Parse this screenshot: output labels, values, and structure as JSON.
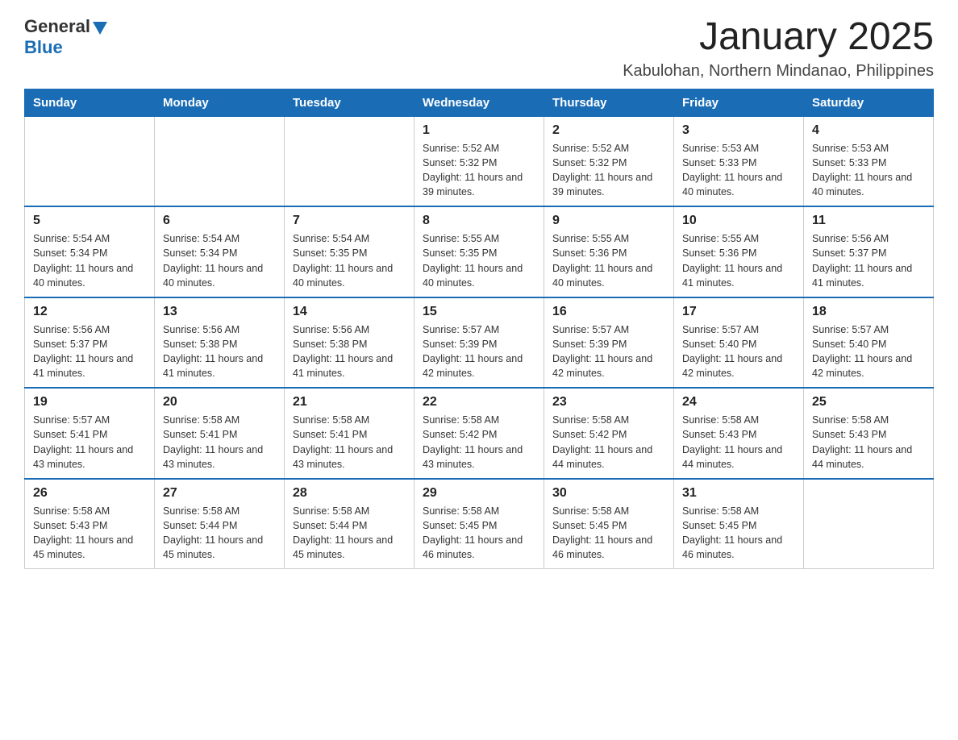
{
  "header": {
    "logo": {
      "general": "General",
      "blue": "Blue"
    },
    "title": "January 2025",
    "subtitle": "Kabulohan, Northern Mindanao, Philippines"
  },
  "columns": [
    "Sunday",
    "Monday",
    "Tuesday",
    "Wednesday",
    "Thursday",
    "Friday",
    "Saturday"
  ],
  "weeks": [
    [
      {
        "day": "",
        "info": ""
      },
      {
        "day": "",
        "info": ""
      },
      {
        "day": "",
        "info": ""
      },
      {
        "day": "1",
        "info": "Sunrise: 5:52 AM\nSunset: 5:32 PM\nDaylight: 11 hours and 39 minutes."
      },
      {
        "day": "2",
        "info": "Sunrise: 5:52 AM\nSunset: 5:32 PM\nDaylight: 11 hours and 39 minutes."
      },
      {
        "day": "3",
        "info": "Sunrise: 5:53 AM\nSunset: 5:33 PM\nDaylight: 11 hours and 40 minutes."
      },
      {
        "day": "4",
        "info": "Sunrise: 5:53 AM\nSunset: 5:33 PM\nDaylight: 11 hours and 40 minutes."
      }
    ],
    [
      {
        "day": "5",
        "info": "Sunrise: 5:54 AM\nSunset: 5:34 PM\nDaylight: 11 hours and 40 minutes."
      },
      {
        "day": "6",
        "info": "Sunrise: 5:54 AM\nSunset: 5:34 PM\nDaylight: 11 hours and 40 minutes."
      },
      {
        "day": "7",
        "info": "Sunrise: 5:54 AM\nSunset: 5:35 PM\nDaylight: 11 hours and 40 minutes."
      },
      {
        "day": "8",
        "info": "Sunrise: 5:55 AM\nSunset: 5:35 PM\nDaylight: 11 hours and 40 minutes."
      },
      {
        "day": "9",
        "info": "Sunrise: 5:55 AM\nSunset: 5:36 PM\nDaylight: 11 hours and 40 minutes."
      },
      {
        "day": "10",
        "info": "Sunrise: 5:55 AM\nSunset: 5:36 PM\nDaylight: 11 hours and 41 minutes."
      },
      {
        "day": "11",
        "info": "Sunrise: 5:56 AM\nSunset: 5:37 PM\nDaylight: 11 hours and 41 minutes."
      }
    ],
    [
      {
        "day": "12",
        "info": "Sunrise: 5:56 AM\nSunset: 5:37 PM\nDaylight: 11 hours and 41 minutes."
      },
      {
        "day": "13",
        "info": "Sunrise: 5:56 AM\nSunset: 5:38 PM\nDaylight: 11 hours and 41 minutes."
      },
      {
        "day": "14",
        "info": "Sunrise: 5:56 AM\nSunset: 5:38 PM\nDaylight: 11 hours and 41 minutes."
      },
      {
        "day": "15",
        "info": "Sunrise: 5:57 AM\nSunset: 5:39 PM\nDaylight: 11 hours and 42 minutes."
      },
      {
        "day": "16",
        "info": "Sunrise: 5:57 AM\nSunset: 5:39 PM\nDaylight: 11 hours and 42 minutes."
      },
      {
        "day": "17",
        "info": "Sunrise: 5:57 AM\nSunset: 5:40 PM\nDaylight: 11 hours and 42 minutes."
      },
      {
        "day": "18",
        "info": "Sunrise: 5:57 AM\nSunset: 5:40 PM\nDaylight: 11 hours and 42 minutes."
      }
    ],
    [
      {
        "day": "19",
        "info": "Sunrise: 5:57 AM\nSunset: 5:41 PM\nDaylight: 11 hours and 43 minutes."
      },
      {
        "day": "20",
        "info": "Sunrise: 5:58 AM\nSunset: 5:41 PM\nDaylight: 11 hours and 43 minutes."
      },
      {
        "day": "21",
        "info": "Sunrise: 5:58 AM\nSunset: 5:41 PM\nDaylight: 11 hours and 43 minutes."
      },
      {
        "day": "22",
        "info": "Sunrise: 5:58 AM\nSunset: 5:42 PM\nDaylight: 11 hours and 43 minutes."
      },
      {
        "day": "23",
        "info": "Sunrise: 5:58 AM\nSunset: 5:42 PM\nDaylight: 11 hours and 44 minutes."
      },
      {
        "day": "24",
        "info": "Sunrise: 5:58 AM\nSunset: 5:43 PM\nDaylight: 11 hours and 44 minutes."
      },
      {
        "day": "25",
        "info": "Sunrise: 5:58 AM\nSunset: 5:43 PM\nDaylight: 11 hours and 44 minutes."
      }
    ],
    [
      {
        "day": "26",
        "info": "Sunrise: 5:58 AM\nSunset: 5:43 PM\nDaylight: 11 hours and 45 minutes."
      },
      {
        "day": "27",
        "info": "Sunrise: 5:58 AM\nSunset: 5:44 PM\nDaylight: 11 hours and 45 minutes."
      },
      {
        "day": "28",
        "info": "Sunrise: 5:58 AM\nSunset: 5:44 PM\nDaylight: 11 hours and 45 minutes."
      },
      {
        "day": "29",
        "info": "Sunrise: 5:58 AM\nSunset: 5:45 PM\nDaylight: 11 hours and 46 minutes."
      },
      {
        "day": "30",
        "info": "Sunrise: 5:58 AM\nSunset: 5:45 PM\nDaylight: 11 hours and 46 minutes."
      },
      {
        "day": "31",
        "info": "Sunrise: 5:58 AM\nSunset: 5:45 PM\nDaylight: 11 hours and 46 minutes."
      },
      {
        "day": "",
        "info": ""
      }
    ]
  ]
}
